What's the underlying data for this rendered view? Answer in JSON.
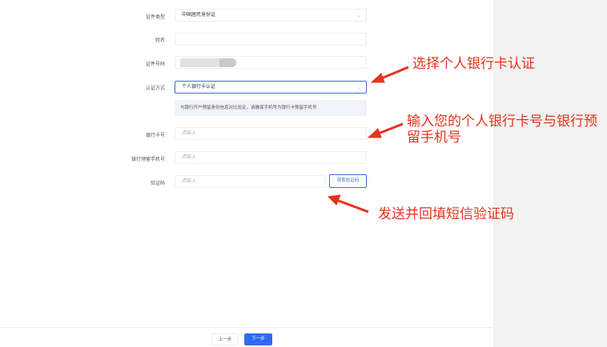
{
  "form": {
    "id_type": {
      "label": "证件类型",
      "value": "中国居民身份证"
    },
    "name": {
      "label": "姓名",
      "value": ""
    },
    "id_number": {
      "label": "证件号码",
      "value": ""
    },
    "auth_method": {
      "label": "认证方式",
      "value": "个人银行卡认证"
    },
    "notice": "与银行开户预留身份信息对比验证，请确保手机号为银行卡预留手机号",
    "bank_card": {
      "label": "银行卡号",
      "placeholder": "请输入"
    },
    "bank_phone": {
      "label": "银行预留手机号",
      "placeholder": "请输入"
    },
    "code": {
      "label": "验证码",
      "placeholder": "请输入",
      "button": "获取验证码"
    }
  },
  "footer": {
    "prev": "上一步",
    "next": "下一步"
  },
  "annotations": {
    "a1": "选择个人银行卡认证",
    "a2": "输入您的个人银行卡号与银行预留手机号",
    "a3": "发送并回填短信验证码"
  },
  "colors": {
    "primary": "#2f6bf0",
    "annotation": "#e8321c"
  }
}
